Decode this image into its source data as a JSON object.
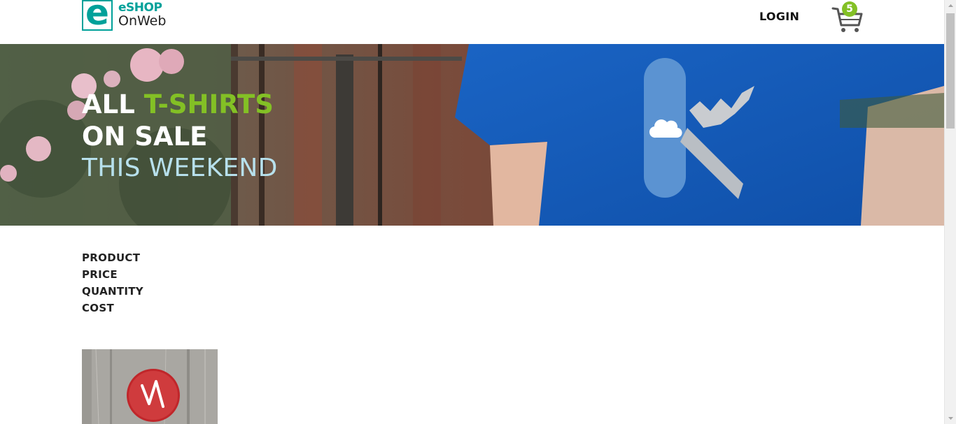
{
  "header": {
    "logo_line1": "eSHOP",
    "logo_line2": "OnWeb",
    "login_label": "LOGIN",
    "cart_count": "5"
  },
  "hero": {
    "line1_prefix": "ALL",
    "line1_accent": "T-SHIRTS",
    "line2": "ON SALE",
    "line3": "THIS WEEKEND"
  },
  "basket": {
    "columns": [
      "PRODUCT",
      "PRICE",
      "QUANTITY",
      "COST"
    ]
  },
  "colors": {
    "brand": "#00a19a",
    "accent": "#83c025",
    "hero_line3": "#b7e0ec"
  },
  "icons": {
    "cart": "cart-icon",
    "scroll_up": "arrow-up-icon",
    "scroll_down": "arrow-down-icon"
  }
}
